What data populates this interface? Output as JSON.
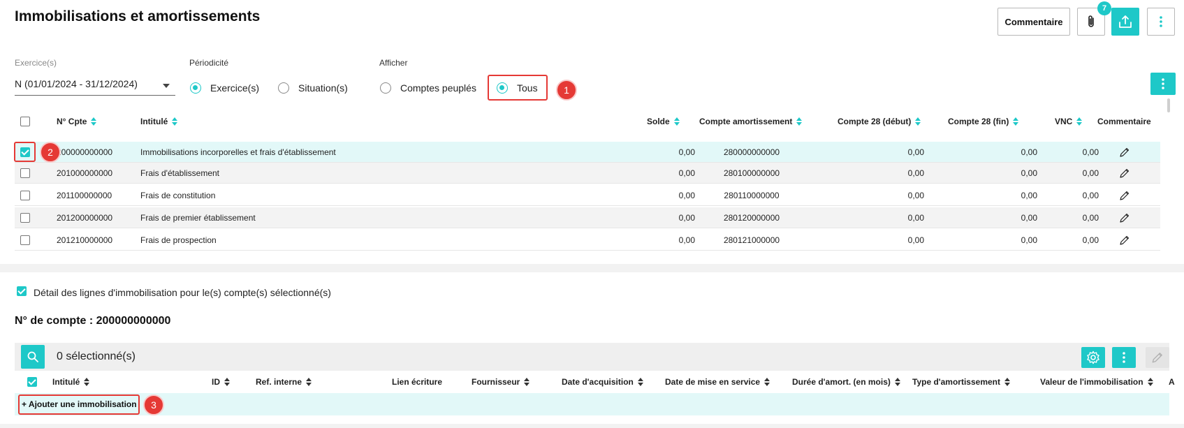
{
  "page": {
    "title": "Immobilisations et amortissements",
    "buttons": {
      "comment": "Commentaire"
    },
    "attachment_count": "7",
    "icons": [
      "paperclip-icon",
      "export-icon",
      "more-vertical-icon"
    ]
  },
  "filters": {
    "exercice_label": "Exercice(s)",
    "exercice_value": "N (01/01/2024 - 31/12/2024)",
    "periodicite_label": "Périodicité",
    "periodicite_options": [
      "Exercice(s)",
      "Situation(s)"
    ],
    "afficher_label": "Afficher",
    "afficher_options": [
      "Comptes peuplés",
      "Tous"
    ]
  },
  "annotations": [
    "1",
    "2",
    "3"
  ],
  "accounts_table": {
    "columns": [
      "N° Cpte",
      "Intitulé",
      "Solde",
      "Compte amortissement",
      "Compte 28 (début)",
      "Compte 28 (fin)",
      "VNC",
      "Commentaire"
    ],
    "rows": [
      {
        "compte": "200000000000",
        "intitule": "Immobilisations incorporelles et frais d'établissement",
        "solde": "0,00",
        "amort": "280000000000",
        "debut": "0,00",
        "fin": "0,00",
        "vnc": "0,00",
        "selected": true
      },
      {
        "compte": "201000000000",
        "intitule": "Frais d'établissement",
        "solde": "0,00",
        "amort": "280100000000",
        "debut": "0,00",
        "fin": "0,00",
        "vnc": "0,00",
        "selected": false
      },
      {
        "compte": "201100000000",
        "intitule": "Frais de constitution",
        "solde": "0,00",
        "amort": "280110000000",
        "debut": "0,00",
        "fin": "0,00",
        "vnc": "0,00",
        "selected": false
      },
      {
        "compte": "201200000000",
        "intitule": "Frais de premier établissement",
        "solde": "0,00",
        "amort": "280120000000",
        "debut": "0,00",
        "fin": "0,00",
        "vnc": "0,00",
        "selected": false
      },
      {
        "compte": "201210000000",
        "intitule": "Frais de prospection",
        "solde": "0,00",
        "amort": "280121000000",
        "debut": "0,00",
        "fin": "0,00",
        "vnc": "0,00",
        "selected": false
      }
    ]
  },
  "detail": {
    "checkbox_label": "Détail des lignes d'immobilisation pour le(s) compte(s) sélectionné(s)",
    "account_title": "N° de compte : 200000000000",
    "selected_count": "0 sélectionné(s)",
    "columns": [
      "Intitulé",
      "ID",
      "Ref. interne",
      "Lien écriture",
      "Fournisseur",
      "Date d'acquisition",
      "Date de mise en service",
      "Durée d'amort. (en mois)",
      "Type d'amortissement",
      "Valeur de l'immobilisation",
      "A"
    ],
    "add_label": "+ Ajouter une immobilisation"
  },
  "colors": {
    "accent": "#1ec8c8",
    "highlight": "#e53935",
    "selected_row": "#e2f8f8"
  }
}
